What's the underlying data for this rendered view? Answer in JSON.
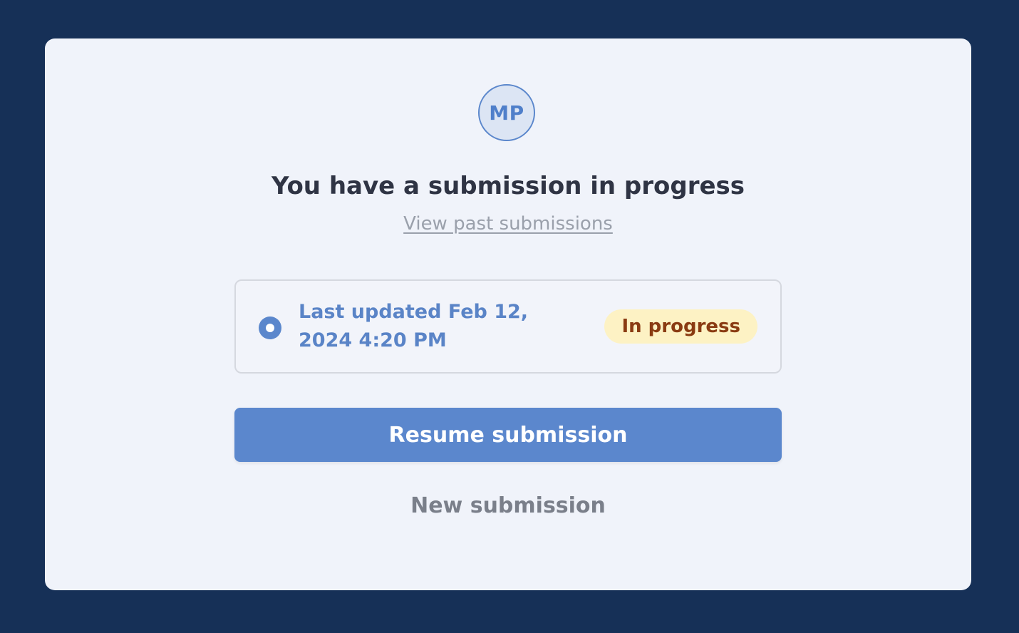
{
  "avatar": {
    "initials": "MP"
  },
  "heading": {
    "title": "You have a submission in progress",
    "past_link": "View past submissions"
  },
  "submission": {
    "updated_text": "Last updated Feb 12, 2024 4:20 PM",
    "status": "In progress",
    "selected": true
  },
  "actions": {
    "resume_label": "Resume submission",
    "new_label": "New submission"
  },
  "colors": {
    "background": "#163057",
    "card": "#f0f3fa",
    "accent": "#5b87cd",
    "badge_bg": "#fdf2c4",
    "badge_text": "#8a3b12"
  }
}
